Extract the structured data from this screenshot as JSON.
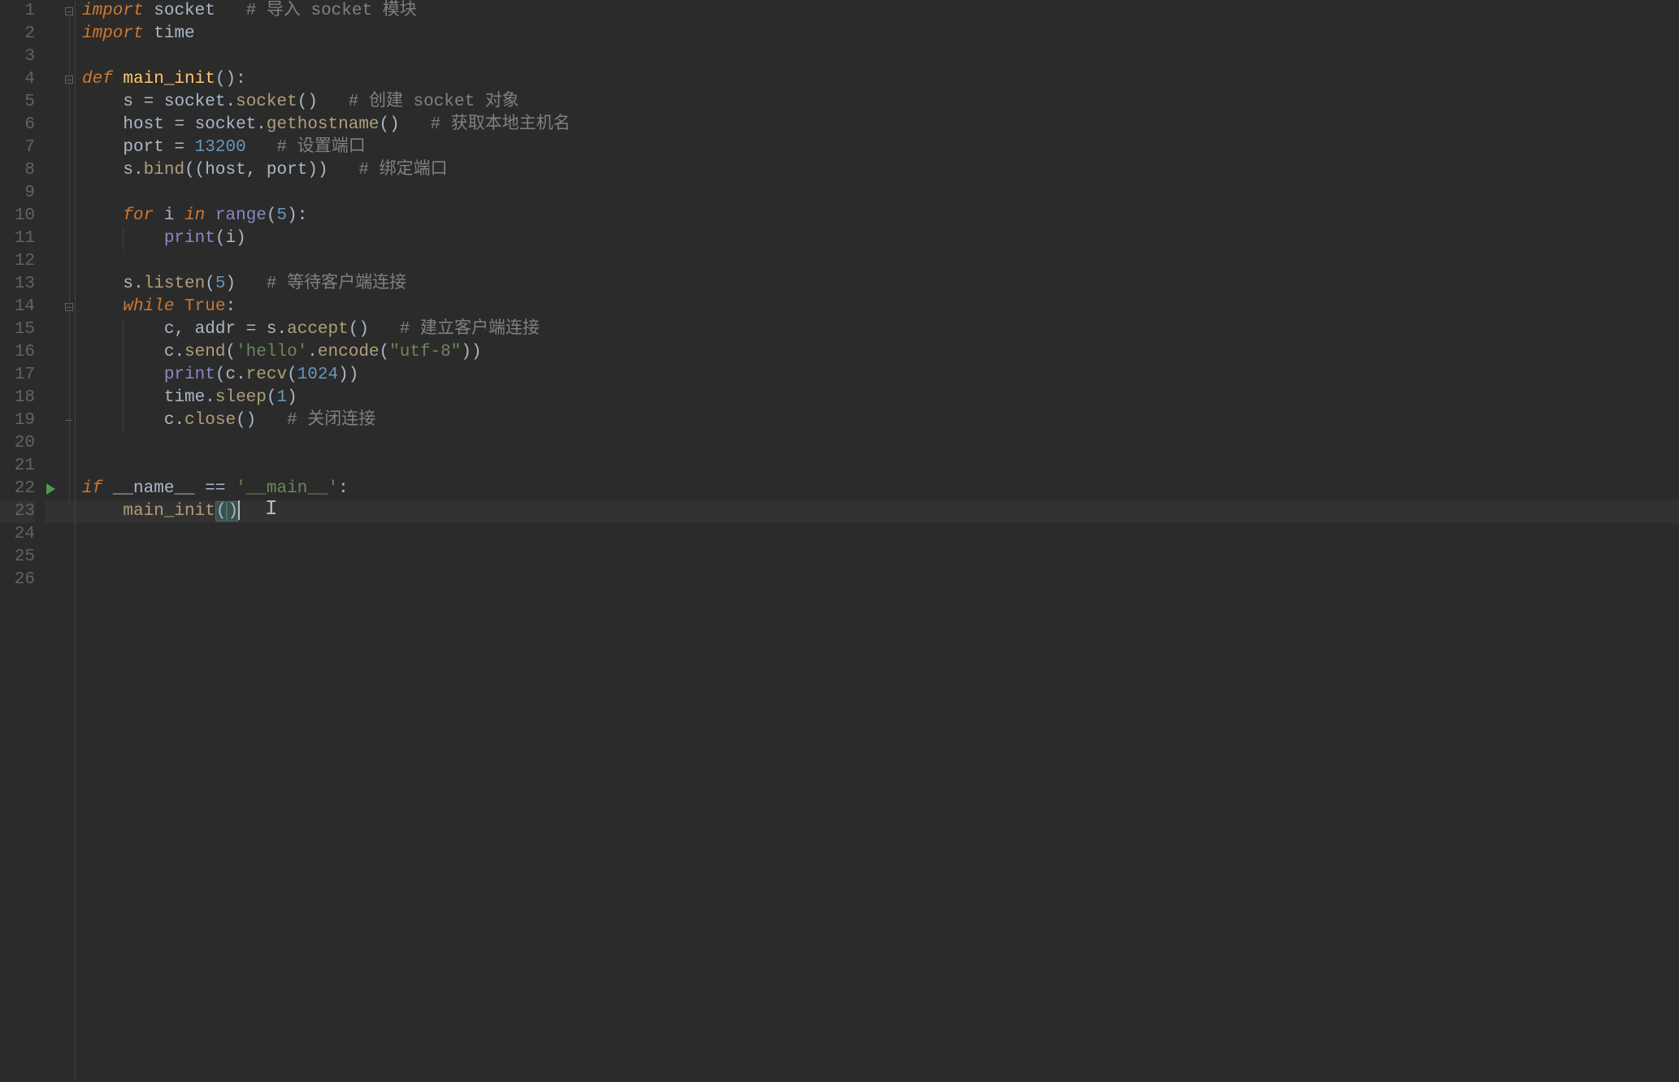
{
  "lines": {
    "count": 26,
    "current": 23
  },
  "code": {
    "l1": {
      "kw": "import",
      "sp1": " ",
      "id": "socket",
      "sp2": "   ",
      "cmt": "# 导入 socket 模块"
    },
    "l2": {
      "kw": "import",
      "sp1": " ",
      "id": "time"
    },
    "l4": {
      "kw": "def",
      "sp1": " ",
      "name": "main_init",
      "paren": "()",
      "colon": ":"
    },
    "l5": {
      "indent": "    ",
      "v": "s",
      "sp1": " ",
      "eq": "=",
      "sp2": " ",
      "mod": "socket",
      "dot": ".",
      "fn": "socket",
      "paren": "()",
      "sp3": "   ",
      "cmt": "# 创建 socket 对象"
    },
    "l6": {
      "indent": "    ",
      "v": "host",
      "sp1": " ",
      "eq": "=",
      "sp2": " ",
      "mod": "socket",
      "dot": ".",
      "fn": "gethostname",
      "paren": "()",
      "sp3": "   ",
      "cmt": "# 获取本地主机名"
    },
    "l7": {
      "indent": "    ",
      "v": "port",
      "sp1": " ",
      "eq": "=",
      "sp2": " ",
      "num": "13200",
      "sp3": "   ",
      "cmt": "# 设置端口"
    },
    "l8": {
      "indent": "    ",
      "v": "s",
      "dot": ".",
      "fn": "bind",
      "po": "((",
      "a1": "host",
      "comma": ", ",
      "a2": "port",
      "pc": "))",
      "sp3": "   ",
      "cmt": "# 绑定端口"
    },
    "l10": {
      "indent": "    ",
      "kw1": "for",
      "sp1": " ",
      "v": "i",
      "sp2": " ",
      "kw2": "in",
      "sp3": " ",
      "fn": "range",
      "po": "(",
      "num": "5",
      "pc": ")",
      "colon": ":"
    },
    "l11": {
      "indent": "        ",
      "fn": "print",
      "po": "(",
      "v": "i",
      "pc": ")"
    },
    "l13": {
      "indent": "    ",
      "v": "s",
      "dot": ".",
      "fn": "listen",
      "po": "(",
      "num": "5",
      "pc": ")",
      "sp3": "   ",
      "cmt": "# 等待客户端连接"
    },
    "l14": {
      "indent": "    ",
      "kw": "while",
      "sp1": " ",
      "val": "True",
      "colon": ":"
    },
    "l15": {
      "indent": "        ",
      "v1": "c",
      "comma": ", ",
      "v2": "addr",
      "sp1": " ",
      "eq": "=",
      "sp2": " ",
      "obj": "s",
      "dot": ".",
      "fn": "accept",
      "paren": "()",
      "sp3": "   ",
      "cmt": "# 建立客户端连接"
    },
    "l16": {
      "indent": "        ",
      "v": "c",
      "dot": ".",
      "fn": "send",
      "po": "(",
      "str1": "'hello'",
      "dot2": ".",
      "fn2": "encode",
      "po2": "(",
      "str2": "\"utf-8\"",
      "pc2": ")",
      "pc": ")"
    },
    "l17": {
      "indent": "        ",
      "fn": "print",
      "po": "(",
      "v": "c",
      "dot": ".",
      "fn2": "recv",
      "po2": "(",
      "num": "1024",
      "pc2": ")",
      "pc": ")"
    },
    "l18": {
      "indent": "        ",
      "mod": "time",
      "dot": ".",
      "fn": "sleep",
      "po": "(",
      "num": "1",
      "pc": ")"
    },
    "l19": {
      "indent": "        ",
      "v": "c",
      "dot": ".",
      "fn": "close",
      "paren": "()",
      "sp3": "   ",
      "cmt": "# 关闭连接"
    },
    "l22": {
      "kw": "if",
      "sp1": " ",
      "dunder": "__name__",
      "sp2": " ",
      "eq": "==",
      "sp3": " ",
      "str": "'__main__'",
      "colon": ":"
    },
    "l23": {
      "indent": "    ",
      "fn": "main_init",
      "po": "(",
      "pc": ")"
    }
  }
}
